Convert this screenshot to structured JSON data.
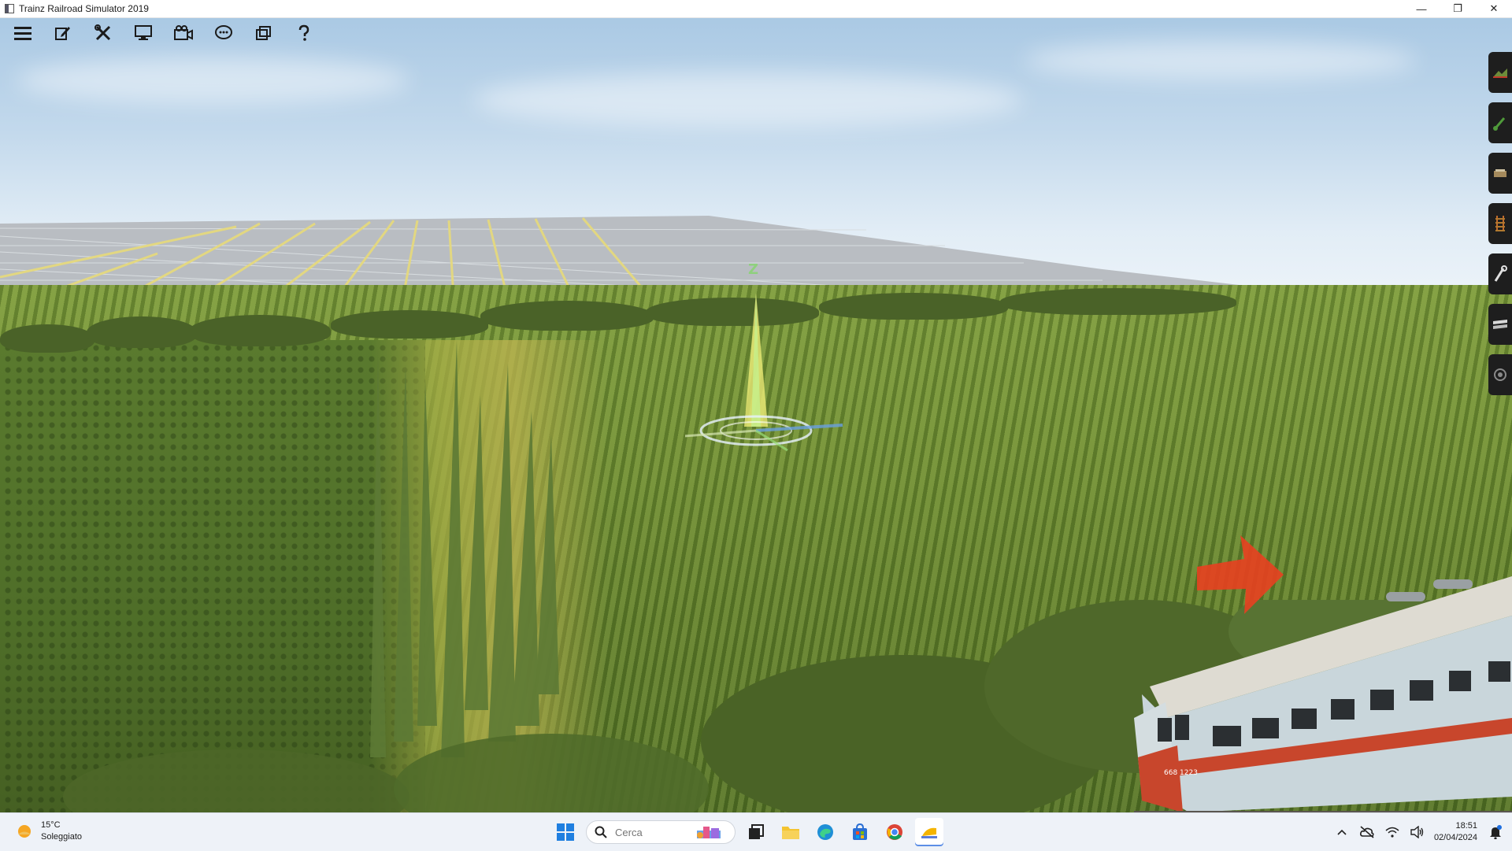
{
  "window": {
    "title": "Trainz Railroad Simulator 2019",
    "minimize_glyph": "—",
    "restore_glyph": "❐",
    "close_glyph": "✕"
  },
  "toolbar": {
    "items": [
      {
        "name": "menu-icon"
      },
      {
        "name": "edit-icon"
      },
      {
        "name": "tools-icon"
      },
      {
        "name": "display-icon"
      },
      {
        "name": "camera-icon"
      },
      {
        "name": "chat-icon"
      },
      {
        "name": "windows-icon"
      },
      {
        "name": "help-icon"
      }
    ]
  },
  "palette": {
    "items": [
      {
        "name": "terrain-tool-icon"
      },
      {
        "name": "paint-tool-icon"
      },
      {
        "name": "objects-tool-icon"
      },
      {
        "name": "track-tool-icon"
      },
      {
        "name": "trackside-tool-icon"
      },
      {
        "name": "layers-tool-icon"
      },
      {
        "name": "settings-tool-icon"
      }
    ]
  },
  "gizmo": {
    "axis_label": "Z"
  },
  "train": {
    "number": "668 1223"
  },
  "taskbar": {
    "weather": {
      "temperature": "15°C",
      "condition": "Soleggiato"
    },
    "search": {
      "placeholder": "Cerca"
    },
    "clock": {
      "time": "18:51",
      "date": "02/04/2024"
    }
  },
  "colors": {
    "sky_top": "#aac9e4",
    "grass": "#6e8e34",
    "palette_bg": "#1e1e1e",
    "arrow_red": "#e84020",
    "train_body": "#c9d6db",
    "train_stripe": "#c8462c"
  }
}
